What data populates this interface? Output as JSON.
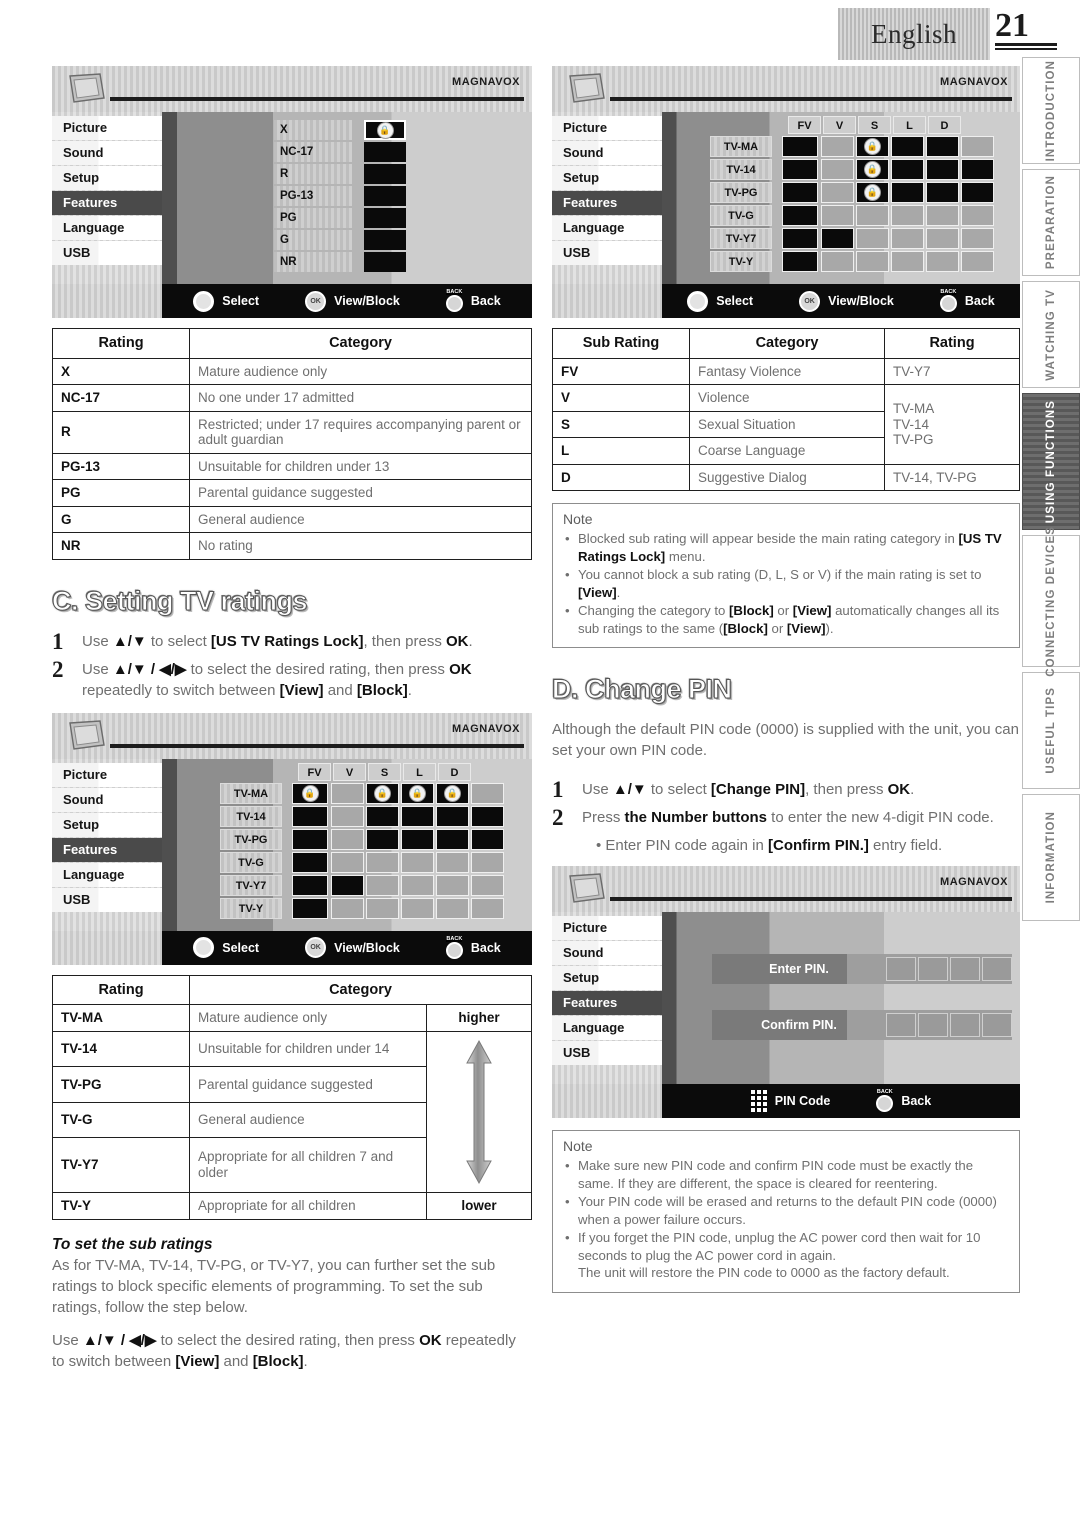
{
  "header": {
    "language": "English",
    "page_number": "21"
  },
  "side_tabs": [
    {
      "label": "INTRODUCTION",
      "active": false
    },
    {
      "label": "PREPARATION",
      "active": false
    },
    {
      "label": "WATCHING TV",
      "active": false
    },
    {
      "label": "USING FUNCTIONS",
      "active": true
    },
    {
      "label": "CONNECTING DEVICES",
      "active": false
    },
    {
      "label": "USEFUL TIPS",
      "active": false
    },
    {
      "label": "INFORMATION",
      "active": false
    }
  ],
  "osd": {
    "brand": "MAGNAVOX",
    "menu_items": [
      "Picture",
      "Sound",
      "Setup",
      "Features",
      "Language",
      "USB"
    ],
    "selected_menu": "Features",
    "footer": {
      "select": "Select",
      "view_block": "View/Block",
      "back": "Back",
      "back_badge": "BACK",
      "ok_badge": "OK",
      "pin_code": "PIN Code"
    },
    "movie_ratings": [
      "X",
      "NC-17",
      "R",
      "PG-13",
      "PG",
      "G",
      "NR"
    ],
    "movie_locked": [
      "X"
    ],
    "sub_columns": [
      "FV",
      "V",
      "S",
      "L",
      "D"
    ],
    "tv_ratings": [
      "TV-MA",
      "TV-14",
      "TV-PG",
      "TV-G",
      "TV-Y7",
      "TV-Y"
    ],
    "pin": {
      "enter_label": "Enter PIN.",
      "confirm_label": "Confirm PIN."
    }
  },
  "movie_table": {
    "headers": [
      "Rating",
      "Category"
    ],
    "rows": [
      {
        "rating": "X",
        "category": "Mature audience only"
      },
      {
        "rating": "NC-17",
        "category": "No one under 17 admitted"
      },
      {
        "rating": "R",
        "category": "Restricted; under 17 requires accompanying parent or adult guardian"
      },
      {
        "rating": "PG-13",
        "category": "Unsuitable for children under 13"
      },
      {
        "rating": "PG",
        "category": "Parental guidance suggested"
      },
      {
        "rating": "G",
        "category": "General audience"
      },
      {
        "rating": "NR",
        "category": "No rating"
      }
    ]
  },
  "section_c": {
    "title": "C. Setting TV ratings",
    "steps": [
      {
        "num": "1",
        "pre": "Use ",
        "arrows": "▲/▼",
        "mid": " to select ",
        "bold1": "[US TV Ratings Lock]",
        "post": ", then press ",
        "bold2": "OK",
        "end": "."
      },
      {
        "num": "2",
        "pre": "Use ",
        "arrows": "▲/▼ / ◀/▶",
        "mid": " to select the desired rating, then press ",
        "bold1": "OK",
        "post": " repeatedly to switch between ",
        "bold2": "[View]",
        "mid2": " and ",
        "bold3": "[Block]",
        "end": "."
      }
    ]
  },
  "tv_table": {
    "headers": [
      "Rating",
      "Category"
    ],
    "higher_label": "higher",
    "lower_label": "lower",
    "rows": [
      {
        "rating": "TV-MA",
        "category": "Mature audience only"
      },
      {
        "rating": "TV-14",
        "category": "Unsuitable for children under 14"
      },
      {
        "rating": "TV-PG",
        "category": "Parental guidance suggested"
      },
      {
        "rating": "TV-G",
        "category": "General audience"
      },
      {
        "rating": "TV-Y7",
        "category": "Appropriate for all children 7 and older"
      },
      {
        "rating": "TV-Y",
        "category": "Appropriate for all children"
      }
    ]
  },
  "sub_ratings_section": {
    "heading": "To set the sub ratings",
    "paragraph": "As for TV-MA, TV-14, TV-PG, or TV-Y7, you can further set the sub ratings to block specific elements of programming. To set the sub ratings, follow the step below.",
    "instruction_pre": "Use ",
    "instruction_arrows": "▲/▼ / ◀/▶",
    "instruction_mid": " to select the desired rating, then press ",
    "instruction_ok": "OK",
    "instruction_post": " repeatedly to switch between ",
    "instruction_view": "[View]",
    "instruction_and": " and ",
    "instruction_block": "[Block]",
    "instruction_end": "."
  },
  "sub_rating_table": {
    "headers": [
      "Sub Rating",
      "Category",
      "Rating"
    ],
    "rows": [
      {
        "sub": "FV",
        "category": "Fantasy Violence",
        "rating": "TV-Y7"
      },
      {
        "sub": "V",
        "category": "Violence",
        "rating": ""
      },
      {
        "sub": "S",
        "category": "Sexual Situation",
        "rating": ""
      },
      {
        "sub": "L",
        "category": "Coarse Language",
        "rating": ""
      },
      {
        "sub": "D",
        "category": "Suggestive Dialog",
        "rating": "TV-14, TV-PG"
      }
    ],
    "merged_rating_lines": [
      "TV-MA",
      "TV-14",
      "TV-PG"
    ]
  },
  "note_sub_ratings": {
    "title": "Note",
    "items": [
      {
        "text": "Blocked sub rating will appear beside the main rating category in ",
        "bold": "[US TV Ratings Lock]",
        "text2": " menu."
      },
      {
        "text": "You cannot block a sub rating (D, L, S or V) if the main rating is set to ",
        "bold": "[View]",
        "text2": "."
      },
      {
        "text": "Changing the category to ",
        "bold": "[Block]",
        "text2": " or ",
        "bold2": "[View]",
        "text3": " automatically changes all its sub ratings to the same (",
        "bold3": "[Block]",
        "text4": " or ",
        "bold4": "[View]",
        "text5": ")."
      }
    ]
  },
  "section_d": {
    "title": "D. Change PIN",
    "intro": "Although the default PIN code (0000) is supplied with the unit, you can set your own PIN code.",
    "steps": [
      {
        "num": "1",
        "pre": "Use ",
        "arrows": "▲/▼",
        "mid": " to select ",
        "bold1": "[Change PIN]",
        "post": ", then press ",
        "bold2": "OK",
        "end": "."
      },
      {
        "num": "2",
        "pre": "Press ",
        "bold1": "the Number buttons",
        "mid": " to enter the new 4-digit PIN code."
      }
    ],
    "bullet_pre": "Enter PIN code again in ",
    "bullet_bold": "[Confirm PIN.]",
    "bullet_post": " entry field."
  },
  "note_pin": {
    "title": "Note",
    "items": [
      {
        "text": "Make sure new PIN code and confirm PIN code must be exactly the same. If they are different, the space is cleared for reentering."
      },
      {
        "text": "Your PIN code will be erased and returns to the default PIN code (0000) when a power failure occurs."
      },
      {
        "text": "If you forget the PIN code, unplug the AC power cord then wait for 10 seconds to plug the AC power cord in again.",
        "cont": "The unit will restore the PIN code to 0000 as the factory default."
      }
    ]
  }
}
